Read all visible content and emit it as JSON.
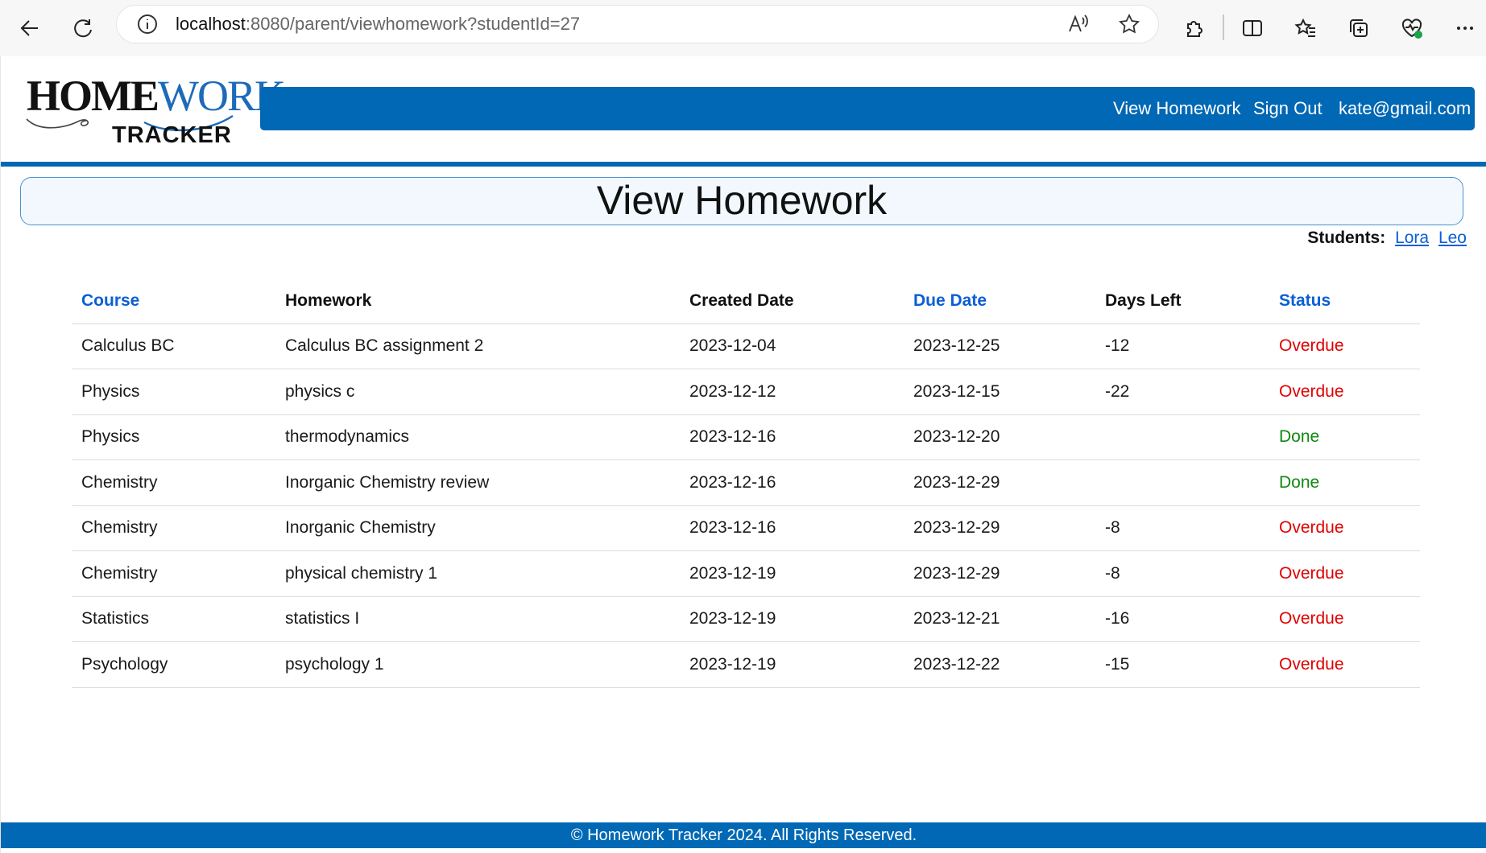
{
  "browser": {
    "url_host": "localhost",
    "url_rest": ":8080/parent/viewhomework?studentId=27"
  },
  "logo": {
    "word_part1": "HOME",
    "word_part2": "WORK",
    "subtitle": "TRACKER"
  },
  "nav": {
    "view_homework": "View Homework",
    "sign_out": "Sign Out",
    "user_email": "kate@gmail.com"
  },
  "page_title": "View Homework",
  "students": {
    "label": "Students:",
    "links": [
      "Lora",
      "Leo"
    ]
  },
  "table": {
    "headers": [
      "Course",
      "Homework",
      "Created Date",
      "Due Date",
      "Days Left",
      "Status"
    ],
    "rows": [
      {
        "course": "Calculus BC",
        "homework": "Calculus BC assignment 2",
        "created": "2023-12-04",
        "due": "2023-12-25",
        "days_left": "-12",
        "status": "Overdue"
      },
      {
        "course": "Physics",
        "homework": "physics c",
        "created": "2023-12-12",
        "due": "2023-12-15",
        "days_left": "-22",
        "status": "Overdue"
      },
      {
        "course": "Physics",
        "homework": "thermodynamics",
        "created": "2023-12-16",
        "due": "2023-12-20",
        "days_left": "",
        "status": "Done"
      },
      {
        "course": "Chemistry",
        "homework": "Inorganic Chemistry review",
        "created": "2023-12-16",
        "due": "2023-12-29",
        "days_left": "",
        "status": "Done"
      },
      {
        "course": "Chemistry",
        "homework": "Inorganic Chemistry",
        "created": "2023-12-16",
        "due": "2023-12-29",
        "days_left": "-8",
        "status": "Overdue"
      },
      {
        "course": "Chemistry",
        "homework": "physical chemistry 1",
        "created": "2023-12-19",
        "due": "2023-12-29",
        "days_left": "-8",
        "status": "Overdue"
      },
      {
        "course": "Statistics",
        "homework": "statistics I",
        "created": "2023-12-19",
        "due": "2023-12-21",
        "days_left": "-16",
        "status": "Overdue"
      },
      {
        "course": "Psychology",
        "homework": "psychology 1",
        "created": "2023-12-19",
        "due": "2023-12-22",
        "days_left": "-15",
        "status": "Overdue"
      }
    ]
  },
  "footer": "© Homework Tracker 2024. All Rights Reserved.",
  "colors": {
    "brand_blue": "#0068b5",
    "link_blue": "#0b5ed7",
    "overdue_red": "#e00000",
    "done_green": "#118811"
  }
}
